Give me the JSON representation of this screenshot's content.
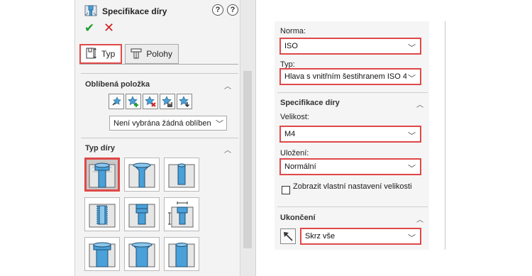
{
  "left_panel": {
    "title": "Specifikace díry",
    "help1": "?",
    "help2": "?",
    "ok_symbol": "✔",
    "cancel_symbol": "✕",
    "tabs": [
      {
        "label": "Typ",
        "active": true
      },
      {
        "label": "Polohy",
        "active": false
      }
    ],
    "favorites": {
      "title": "Oblíbená položka",
      "icons": [
        "apply-favorite-icon",
        "add-favorite-icon",
        "delete-favorite-icon",
        "save-favorite-icon",
        "load-favorite-icon"
      ],
      "select_value": "Není vybrána žádná oblíben"
    },
    "hole_type": {
      "title": "Typ díry",
      "tiles": [
        "counterbore",
        "countersink",
        "hole",
        "straight-tap",
        "tapered-tap",
        "legacy-hole",
        "counterbore-slot",
        "countersink-slot",
        "slot"
      ],
      "selected_index": 0
    }
  },
  "right_panel": {
    "norma_label": "Norma:",
    "norma_value": "ISO",
    "typ_label": "Typ:",
    "typ_value": "Hlava s vnitřním šestihranem ISO 4",
    "spec_title": "Specifikace díry",
    "size_label": "Velikost:",
    "size_value": "M4",
    "fit_label": "Uložení:",
    "fit_value": "Normální",
    "custom_size_label": "Zobrazit vlastní nastavení velikosti",
    "end_title": "Ukončení",
    "end_value": "Skrz vše"
  },
  "colors": {
    "highlight": "#e04848",
    "ok": "#1e9e2e",
    "cancel": "#d42020",
    "icon_blue": "#4aa0d8"
  }
}
